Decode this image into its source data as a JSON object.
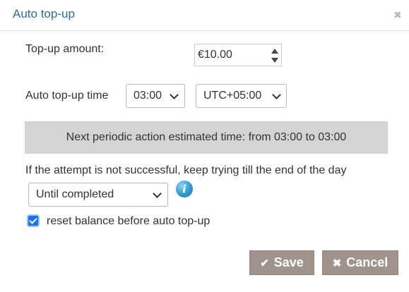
{
  "dialog": {
    "title": "Auto top-up",
    "close_icon": "close-icon"
  },
  "amount": {
    "label": "Top-up amount:",
    "value": "€10.00"
  },
  "time": {
    "label": "Auto top-up time",
    "hour_value": "03:00",
    "timezone_value": "UTC+05:00"
  },
  "banner": {
    "text": "Next periodic action estimated time: from 03:00 to 03:00"
  },
  "retry": {
    "label": "If the attempt is not successful, keep trying till the end of the day",
    "value": "Until completed",
    "info_icon": "info-icon"
  },
  "reset": {
    "label": "reset balance before auto top-up",
    "checked": true
  },
  "buttons": {
    "save_label": "Save",
    "cancel_label": "Cancel",
    "save_icon": "check-icon",
    "cancel_icon": "x-icon"
  },
  "colors": {
    "title": "#2f6b9a",
    "banner_bg": "#d4d4d4",
    "button_bg": "#a0938b",
    "checkbox_accent": "#1a73e8"
  }
}
